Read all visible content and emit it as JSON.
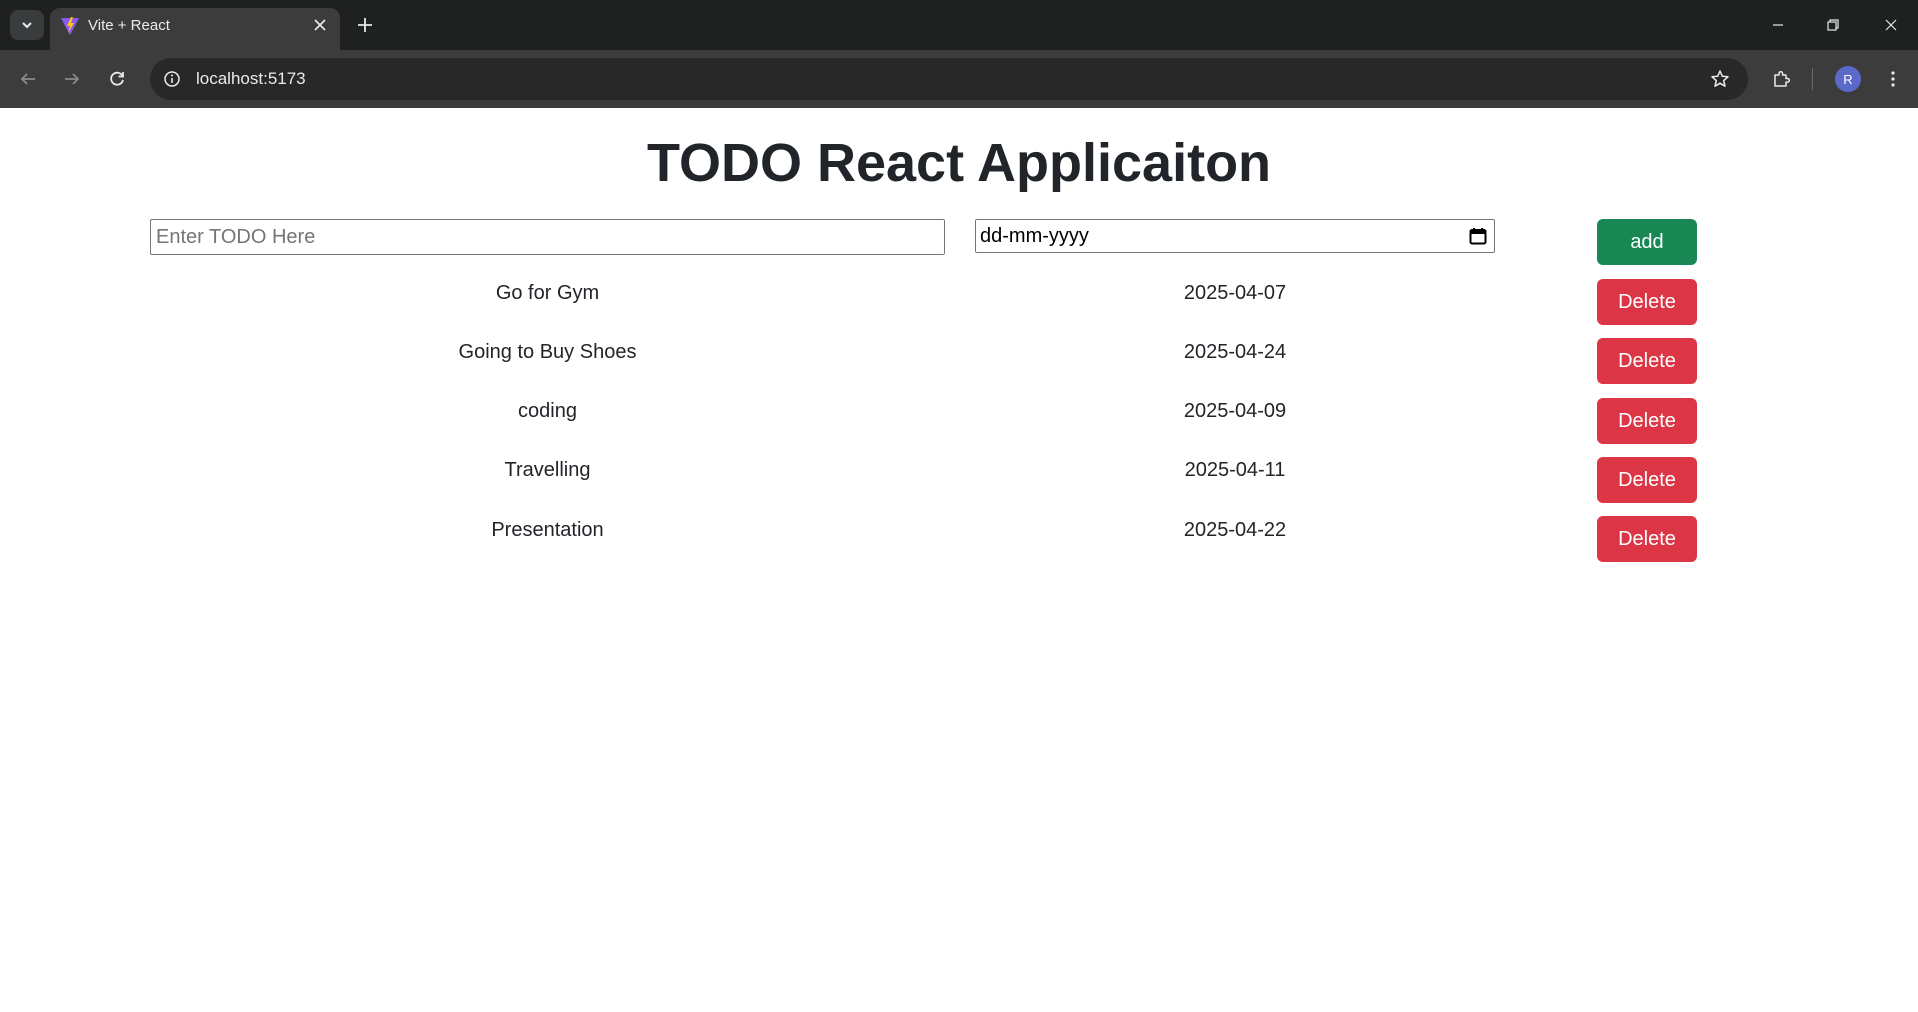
{
  "browser": {
    "tab_title": "Vite + React",
    "url": "localhost:5173",
    "profile_initial": "R"
  },
  "app": {
    "title": "TODO React Applicaiton",
    "input_placeholder": "Enter TODO Here",
    "date_placeholder": "dd-mm-yyyy",
    "add_label": "add",
    "delete_label": "Delete",
    "todos": [
      {
        "name": "Go for Gym",
        "date": "2025-04-07"
      },
      {
        "name": "Going to Buy Shoes",
        "date": "2025-04-24"
      },
      {
        "name": "coding",
        "date": "2025-04-09"
      },
      {
        "name": "Travelling",
        "date": "2025-04-11"
      },
      {
        "name": "Presentation",
        "date": "2025-04-22"
      }
    ]
  },
  "colors": {
    "add_button": "#198754",
    "delete_button": "#dc3545"
  }
}
